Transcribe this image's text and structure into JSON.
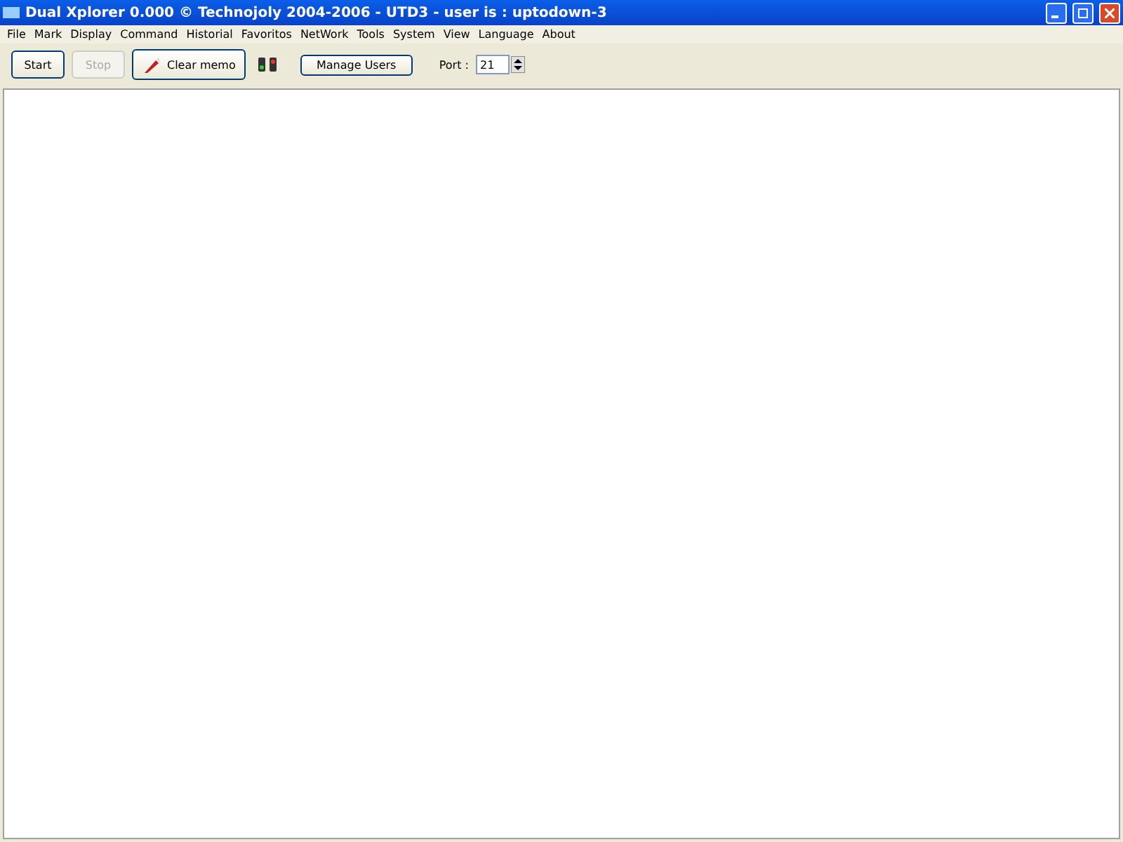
{
  "window": {
    "title": "Dual Xplorer 0.000 © Technojoly 2004-2006 - UTD3 - user is : uptodown-3"
  },
  "menu": [
    "File",
    "Mark",
    "Display",
    "Command",
    "Historial",
    "Favoritos",
    "NetWork",
    "Tools",
    "System",
    "View",
    "Language",
    "About"
  ],
  "toolbar": {
    "buttons": [
      {
        "label": "Start",
        "kind": "plain",
        "disabled": false
      },
      {
        "label": "Stop",
        "kind": "plain",
        "disabled": true
      },
      {
        "label": "Clear memo",
        "kind": "icon",
        "disabled": false
      },
      {
        "label": "Manage Users",
        "kind": "wide",
        "disabled": false
      }
    ],
    "port": {
      "label": "Port :",
      "value": "21"
    }
  }
}
